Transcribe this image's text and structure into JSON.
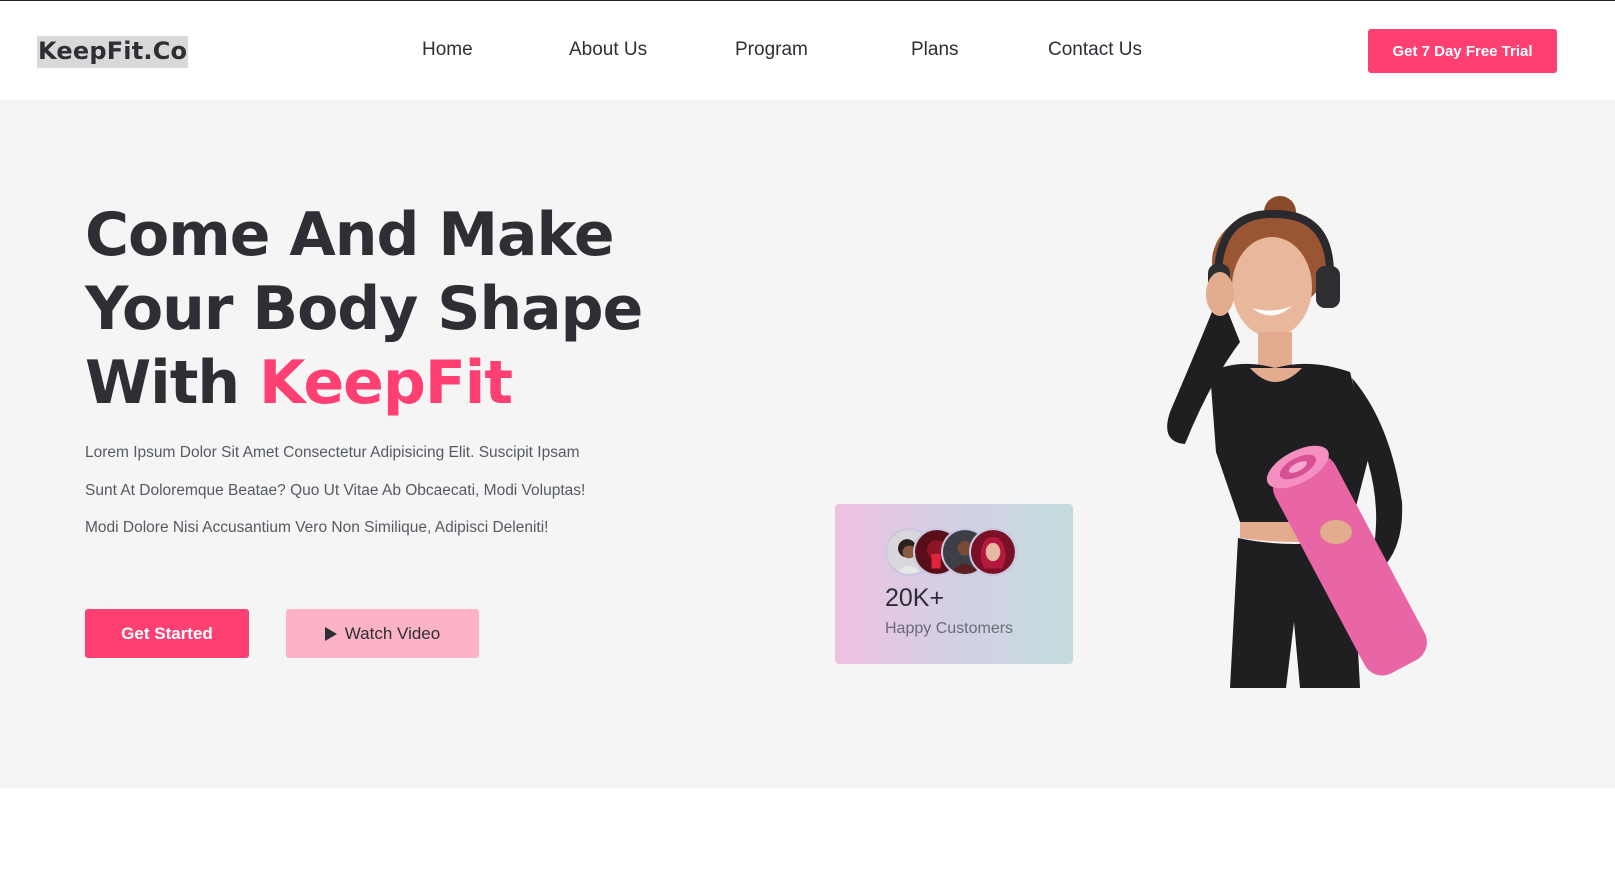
{
  "header": {
    "logo": "KeepFit.Co",
    "nav": [
      {
        "label": "Home"
      },
      {
        "label": "About Us"
      },
      {
        "label": "Program"
      },
      {
        "label": "Plans"
      },
      {
        "label": "Contact Us"
      }
    ],
    "cta_label": "Get 7 Day Free Trial"
  },
  "hero": {
    "headline_line1": "Come And Make",
    "headline_line2": "Your Body Shape",
    "headline_line3_prefix": "With ",
    "headline_accent": "KeepFit",
    "description_lines": [
      "Lorem Ipsum Dolor Sit Amet Consectetur Adipisicing Elit. Suscipit Ipsam",
      "Sunt At Doloremque Beatae? Quo Ut Vitae Ab Obcaecati, Modi Voluptas!",
      "Modi Dolore Nisi Accusantium Vero Non Similique, Adipisci Deleniti!"
    ],
    "primary_button": "Get Started",
    "secondary_button": "Watch Video"
  },
  "stats_card": {
    "count": "20K+",
    "label": "Happy Customers"
  },
  "colors": {
    "accent": "#fd3f72",
    "accent_light": "#fcb3c6",
    "text_dark": "#2d2f35",
    "hero_bg": "#f5f5f5"
  },
  "icons": {
    "watch_video": "play-icon"
  }
}
